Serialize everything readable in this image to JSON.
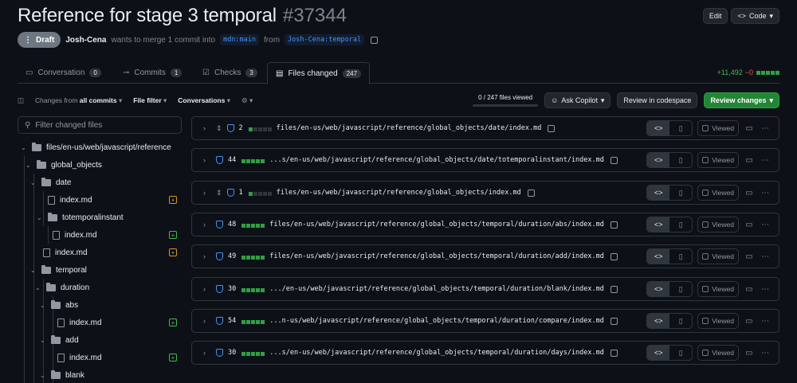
{
  "pr": {
    "title": "Reference for stage 3 temporal",
    "number": "#37344",
    "status": "Draft",
    "author": "Josh-Cena",
    "merge_text": "wants to merge 1 commit into",
    "base_branch": "mdn:main",
    "from_text": "from",
    "head_branch": "Josh-Cena:temporal"
  },
  "top_actions": {
    "edit": "Edit",
    "code": "Code"
  },
  "tabs": [
    {
      "label": "Conversation",
      "count": "0",
      "icon": "comment-icon"
    },
    {
      "label": "Commits",
      "count": "1",
      "icon": "commit-icon"
    },
    {
      "label": "Checks",
      "count": "3",
      "icon": "checks-icon"
    },
    {
      "label": "Files changed",
      "count": "247",
      "icon": "file-diff-icon"
    }
  ],
  "diffstat": {
    "additions": "+11,492",
    "deletions": "−0"
  },
  "toolbar": {
    "changes_from_prefix": "Changes from",
    "changes_from_value": "all commits",
    "file_filter": "File filter",
    "conversations": "Conversations",
    "files_viewed": "0 / 247 files viewed",
    "ask_copilot": "Ask Copilot",
    "review_codespace": "Review in codespace",
    "review_changes": "Review changes"
  },
  "filter_placeholder": "Filter changed files",
  "tree": [
    {
      "label": "files/en-us/web/javascript/reference",
      "type": "folder"
    },
    {
      "label": "global_objects",
      "type": "folder"
    },
    {
      "label": "date",
      "type": "folder"
    },
    {
      "label": "index.md",
      "type": "file",
      "status": "modified"
    },
    {
      "label": "totemporalinstant",
      "type": "folder"
    },
    {
      "label": "index.md",
      "type": "file",
      "status": "added"
    },
    {
      "label": "index.md",
      "type": "file",
      "status": "modified"
    },
    {
      "label": "temporal",
      "type": "folder"
    },
    {
      "label": "duration",
      "type": "folder"
    },
    {
      "label": "abs",
      "type": "folder"
    },
    {
      "label": "index.md",
      "type": "file",
      "status": "added"
    },
    {
      "label": "add",
      "type": "folder"
    },
    {
      "label": "index.md",
      "type": "file",
      "status": "added"
    },
    {
      "label": "blank",
      "type": "folder"
    }
  ],
  "files": [
    {
      "count": "2",
      "path": "files/en-us/web/javascript/reference/global_objects/date/index.md",
      "bar": 1,
      "expandable": true
    },
    {
      "count": "44",
      "path": "...s/en-us/web/javascript/reference/global_objects/date/totemporalinstant/index.md",
      "bar": 5,
      "expandable": false
    },
    {
      "count": "1",
      "path": "files/en-us/web/javascript/reference/global_objects/index.md",
      "bar": 1,
      "expandable": true
    },
    {
      "count": "48",
      "path": "files/en-us/web/javascript/reference/global_objects/temporal/duration/abs/index.md",
      "bar": 5,
      "expandable": false
    },
    {
      "count": "49",
      "path": "files/en-us/web/javascript/reference/global_objects/temporal/duration/add/index.md",
      "bar": 5,
      "expandable": false
    },
    {
      "count": "30",
      "path": ".../en-us/web/javascript/reference/global_objects/temporal/duration/blank/index.md",
      "bar": 5,
      "expandable": false
    },
    {
      "count": "54",
      "path": "...n-us/web/javascript/reference/global_objects/temporal/duration/compare/index.md",
      "bar": 5,
      "expandable": false
    },
    {
      "count": "30",
      "path": "...s/en-us/web/javascript/reference/global_objects/temporal/duration/days/index.md",
      "bar": 5,
      "expandable": false
    }
  ],
  "viewed_label": "Viewed"
}
